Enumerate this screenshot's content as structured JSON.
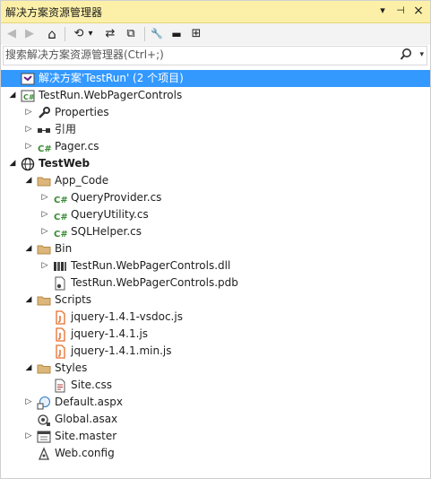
{
  "window": {
    "title": "解决方案资源管理器",
    "pin_glyph": "⊣",
    "close_glyph": "×",
    "dropdown_glyph": "▾"
  },
  "toolbar": {
    "back_glyph": "◀",
    "forward_glyph": "▶",
    "home_glyph": "⌂",
    "history_glyph": "⟲",
    "history_drop_glyph": "▾",
    "sync_glyph": "⇄",
    "collapse_glyph": "⧉",
    "properties_glyph": "🔧",
    "show_all_glyph": "▬",
    "view_class_glyph": "⊞"
  },
  "search": {
    "placeholder": "搜索解决方案资源管理器(Ctrl+;)",
    "value": "",
    "icon": "search-icon",
    "dropdown_glyph": "▾"
  },
  "tree": {
    "nodes": [
      {
        "label": "解决方案'TestRun' (2 个项目)",
        "icon": "solution-icon",
        "expander": "",
        "selected": true
      },
      {
        "label": "TestRun.WebPagerControls",
        "icon": "csharp-project-icon",
        "expander": "◢"
      },
      {
        "label": "Properties",
        "icon": "wrench-icon",
        "expander": "▷"
      },
      {
        "label": "引用",
        "icon": "references-icon",
        "expander": "▷"
      },
      {
        "label": "Pager.cs",
        "icon": "csharp-file-icon",
        "expander": "▷"
      },
      {
        "label": "TestWeb",
        "icon": "globe-icon",
        "expander": "◢",
        "bold": true
      },
      {
        "label": "App_Code",
        "icon": "folder-icon",
        "expander": "◢"
      },
      {
        "label": "QueryProvider.cs",
        "icon": "csharp-file-icon",
        "expander": "▷"
      },
      {
        "label": "QueryUtility.cs",
        "icon": "csharp-file-icon",
        "expander": "▷"
      },
      {
        "label": "SQLHelper.cs",
        "icon": "csharp-file-icon",
        "expander": "▷"
      },
      {
        "label": "Bin",
        "icon": "folder-icon",
        "expander": "◢"
      },
      {
        "label": "TestRun.WebPagerControls.dll",
        "icon": "dll-icon",
        "expander": "▷"
      },
      {
        "label": "TestRun.WebPagerControls.pdb",
        "icon": "file-icon",
        "expander": ""
      },
      {
        "label": "Scripts",
        "icon": "folder-icon",
        "expander": "◢"
      },
      {
        "label": "jquery-1.4.1-vsdoc.js",
        "icon": "javascript-icon",
        "expander": ""
      },
      {
        "label": "jquery-1.4.1.js",
        "icon": "javascript-icon",
        "expander": ""
      },
      {
        "label": "jquery-1.4.1.min.js",
        "icon": "javascript-icon",
        "expander": ""
      },
      {
        "label": "Styles",
        "icon": "folder-icon",
        "expander": "◢"
      },
      {
        "label": "Site.css",
        "icon": "stylesheet-icon",
        "expander": ""
      },
      {
        "label": "Default.aspx",
        "icon": "aspx-page-icon",
        "expander": "▷"
      },
      {
        "label": "Global.asax",
        "icon": "asax-icon",
        "expander": ""
      },
      {
        "label": "Site.master",
        "icon": "master-page-icon",
        "expander": "▷"
      },
      {
        "label": "Web.config",
        "icon": "config-icon",
        "expander": ""
      }
    ]
  },
  "colors": {
    "title_bar": "#fcf0a8",
    "selection": "#3399ff",
    "folder": "#dcb67a",
    "csharp": "#388a34",
    "javascript": "#e76d2e"
  }
}
